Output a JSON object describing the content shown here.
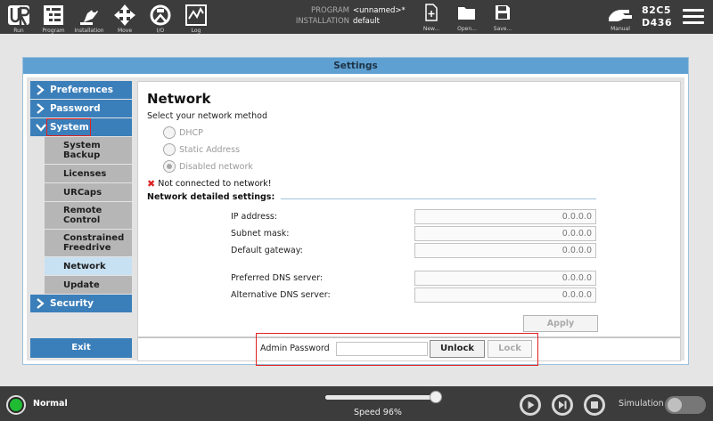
{
  "topbar": {
    "nav": [
      {
        "label": "Run",
        "icon": "ur-logo-icon"
      },
      {
        "label": "Program",
        "icon": "program-icon"
      },
      {
        "label": "Installation",
        "icon": "installation-icon"
      },
      {
        "label": "Move",
        "icon": "move-icon"
      },
      {
        "label": "I/O",
        "icon": "io-icon"
      },
      {
        "label": "Log",
        "icon": "log-icon"
      }
    ],
    "program_key": "PROGRAM",
    "program_value": "<unnamed>*",
    "installation_key": "INSTALLATION",
    "installation_value": "default",
    "file_buttons": [
      {
        "label": "New...",
        "icon": "new-file-icon"
      },
      {
        "label": "Open...",
        "icon": "open-folder-icon"
      },
      {
        "label": "Save...",
        "icon": "save-icon"
      }
    ],
    "mode_label": "Manual",
    "robot_id_1": "82C5",
    "robot_id_2": "D436"
  },
  "settings": {
    "title": "Settings",
    "sidebar": {
      "preferences": "Preferences",
      "password": "Password",
      "system": "System",
      "sub": [
        {
          "label": "System Backup"
        },
        {
          "label": "Licenses"
        },
        {
          "label": "URCaps"
        },
        {
          "label": "Remote Control"
        },
        {
          "label": "Constrained Freedrive"
        },
        {
          "label": "Network"
        },
        {
          "label": "Update"
        }
      ],
      "security": "Security",
      "exit": "Exit"
    },
    "network": {
      "title": "Network",
      "subtitle": "Select your network method",
      "options": [
        "DHCP",
        "Static Address",
        "Disabled network"
      ],
      "selected": "Disabled network",
      "warning": "Not connected to network!",
      "details_heading": "Network detailed settings:",
      "fields": [
        {
          "label": "IP address:",
          "value": "0.0.0.0"
        },
        {
          "label": "Subnet mask:",
          "value": "0.0.0.0"
        },
        {
          "label": "Default gateway:",
          "value": "0.0.0.0"
        },
        {
          "label": "Preferred DNS server:",
          "value": "0.0.0.0"
        },
        {
          "label": "Alternative DNS server:",
          "value": "0.0.0.0"
        }
      ],
      "apply": "Apply"
    },
    "admin": {
      "label": "Admin Password",
      "value": "",
      "unlock": "Unlock",
      "lock": "Lock"
    }
  },
  "bottombar": {
    "status": "Normal",
    "status_color": "#1fbb33",
    "speed_label": "Speed 96%",
    "speed_fraction": 0.96,
    "simulation_label": "Simulation"
  },
  "colors": {
    "accent": "#3b7fba",
    "title_bar": "#5fa0d2",
    "highlight": "#e02020"
  }
}
